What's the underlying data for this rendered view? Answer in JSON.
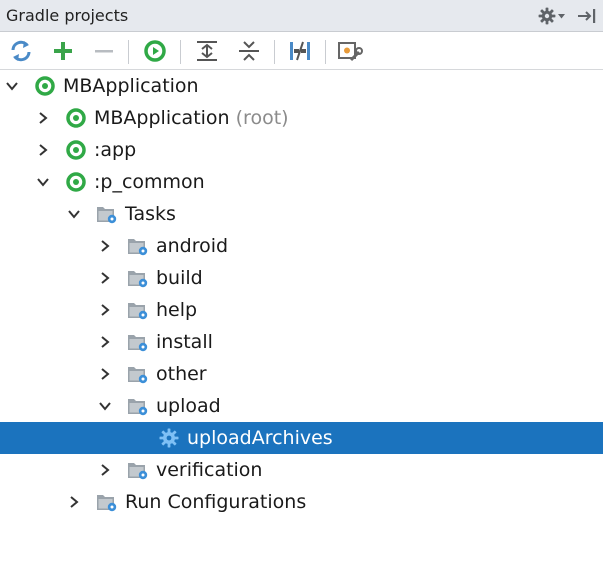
{
  "header": {
    "title": "Gradle projects"
  },
  "colors": {
    "selection": "#1b73be",
    "gradle_green": "#30a946",
    "refresh_blue": "#4a8ac7",
    "add_green": "#3aa44a",
    "folder_gray": "#9aa3ab",
    "gear_blue": "#3c8fd8"
  },
  "toolbar": {
    "icons": [
      "refresh-all-icon",
      "add-project-icon",
      "remove-project-icon",
      "execute-task-icon",
      "expand-all-icon",
      "collapse-all-icon",
      "toggle-offline-icon",
      "settings-icon"
    ]
  },
  "tree": [
    {
      "id": "mbapp-root",
      "label": "MBApplication",
      "icon": "gradle-icon",
      "expanded": true
    },
    {
      "id": "mbapp",
      "label": "MBApplication",
      "suffix": "(root)",
      "icon": "gradle-icon",
      "expanded": false
    },
    {
      "id": "app",
      "label": ":app",
      "icon": "gradle-icon",
      "expanded": false
    },
    {
      "id": "p-common",
      "label": ":p_common",
      "icon": "gradle-icon",
      "expanded": true
    },
    {
      "id": "tasks",
      "label": "Tasks",
      "icon": "task-folder-icon",
      "expanded": true
    },
    {
      "id": "android",
      "label": "android",
      "icon": "task-folder-icon",
      "expanded": false
    },
    {
      "id": "build",
      "label": "build",
      "icon": "task-folder-icon",
      "expanded": false
    },
    {
      "id": "help",
      "label": "help",
      "icon": "task-folder-icon",
      "expanded": false
    },
    {
      "id": "install",
      "label": "install",
      "icon": "task-folder-icon",
      "expanded": false
    },
    {
      "id": "other",
      "label": "other",
      "icon": "task-folder-icon",
      "expanded": false
    },
    {
      "id": "upload",
      "label": "upload",
      "icon": "task-folder-icon",
      "expanded": true
    },
    {
      "id": "upload-archives",
      "label": "uploadArchives",
      "icon": "task-gear-icon",
      "selected": true
    },
    {
      "id": "verification",
      "label": "verification",
      "icon": "task-folder-icon",
      "expanded": false
    },
    {
      "id": "run-configs",
      "label": "Run Configurations",
      "icon": "task-folder-icon",
      "expanded": false
    }
  ]
}
